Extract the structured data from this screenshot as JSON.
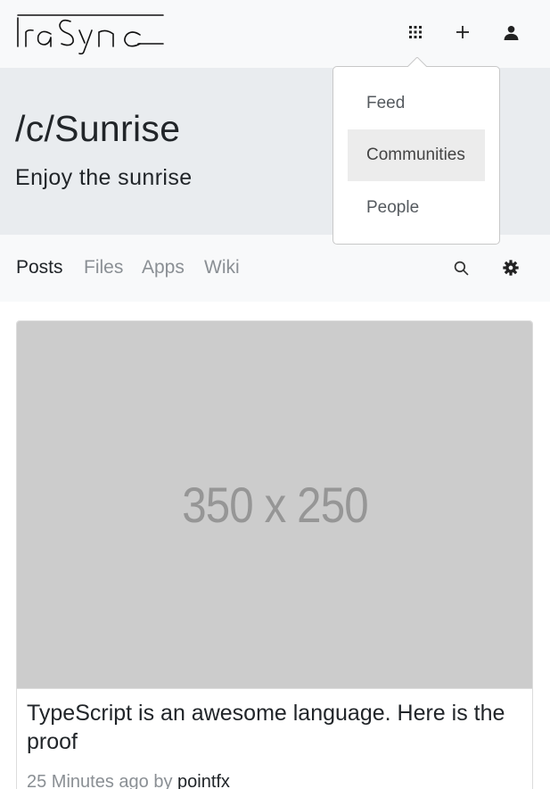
{
  "brand": {
    "logo_text": "IraSync"
  },
  "navbar": {
    "apps_icon": "grid-icon",
    "add_icon": "plus-icon",
    "user_icon": "user-icon"
  },
  "dropdown": {
    "items": [
      {
        "label": "Feed",
        "highlighted": false
      },
      {
        "label": "Communities",
        "highlighted": true
      },
      {
        "label": "People",
        "highlighted": false
      }
    ]
  },
  "banner": {
    "title": "/c/Sunrise",
    "subtitle": "Enjoy the sunrise"
  },
  "tabs": {
    "items": [
      {
        "label": "Posts",
        "active": true
      },
      {
        "label": "Files",
        "active": false
      },
      {
        "label": "Apps",
        "active": false
      },
      {
        "label": "Wiki",
        "active": false
      }
    ],
    "search_icon": "search-icon",
    "settings_icon": "gear-icon"
  },
  "post": {
    "image_placeholder": "350 x 250",
    "title": "TypeScript is an awesome language. Here is the proof",
    "time_ago": "25 Minutes ago by",
    "author": "pointfx"
  },
  "colors": {
    "navbar_bg": "#f8f9fa",
    "banner_bg": "#e9ecef",
    "placeholder_bg": "#cccccc",
    "muted_text": "#8a8f94"
  }
}
